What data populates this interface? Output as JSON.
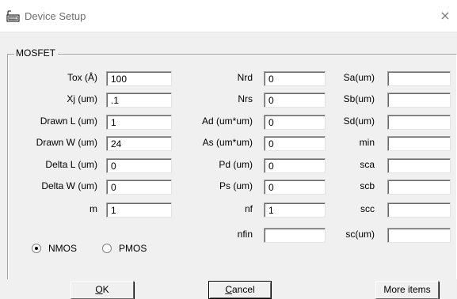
{
  "window": {
    "title": "Device Setup",
    "close_glyph": "×",
    "icon": "device-setup-icon"
  },
  "group": {
    "label": "MOSFET"
  },
  "columns": [
    [
      {
        "label": "Tox (Å)",
        "value": "100"
      },
      {
        "label": "Xj (um)",
        "value": ".1"
      },
      {
        "label": "Drawn L (um)",
        "value": "1"
      },
      {
        "label": "Drawn W (um)",
        "value": "24"
      },
      {
        "label": "Delta L (um)",
        "value": "0"
      },
      {
        "label": "Delta W (um)",
        "value": "0"
      },
      {
        "label": "m",
        "value": "1"
      }
    ],
    [
      {
        "label": "Nrd",
        "value": "0"
      },
      {
        "label": "Nrs",
        "value": "0"
      },
      {
        "label": "Ad (um*um)",
        "value": "0"
      },
      {
        "label": "As (um*um)",
        "value": "0"
      },
      {
        "label": "Pd (um)",
        "value": "0"
      },
      {
        "label": "Ps (um)",
        "value": "0"
      },
      {
        "label": "nf",
        "value": "1"
      },
      {
        "label": "nfin",
        "value": ""
      }
    ],
    [
      {
        "label": "Sa(um)",
        "value": ""
      },
      {
        "label": "Sb(um)",
        "value": ""
      },
      {
        "label": "Sd(um)",
        "value": ""
      },
      {
        "label": "min",
        "value": ""
      },
      {
        "label": "sca",
        "value": ""
      },
      {
        "label": "scb",
        "value": ""
      },
      {
        "label": "scc",
        "value": ""
      },
      {
        "label": "sc(um)",
        "value": ""
      }
    ]
  ],
  "device_type": {
    "options": [
      {
        "label": "NMOS",
        "selected": true
      },
      {
        "label": "PMOS",
        "selected": false
      }
    ]
  },
  "buttons": {
    "ok": {
      "mnemonic": "O",
      "rest": "K"
    },
    "cancel": {
      "mnemonic": "C",
      "rest": "ancel"
    },
    "more_items": "More items"
  }
}
